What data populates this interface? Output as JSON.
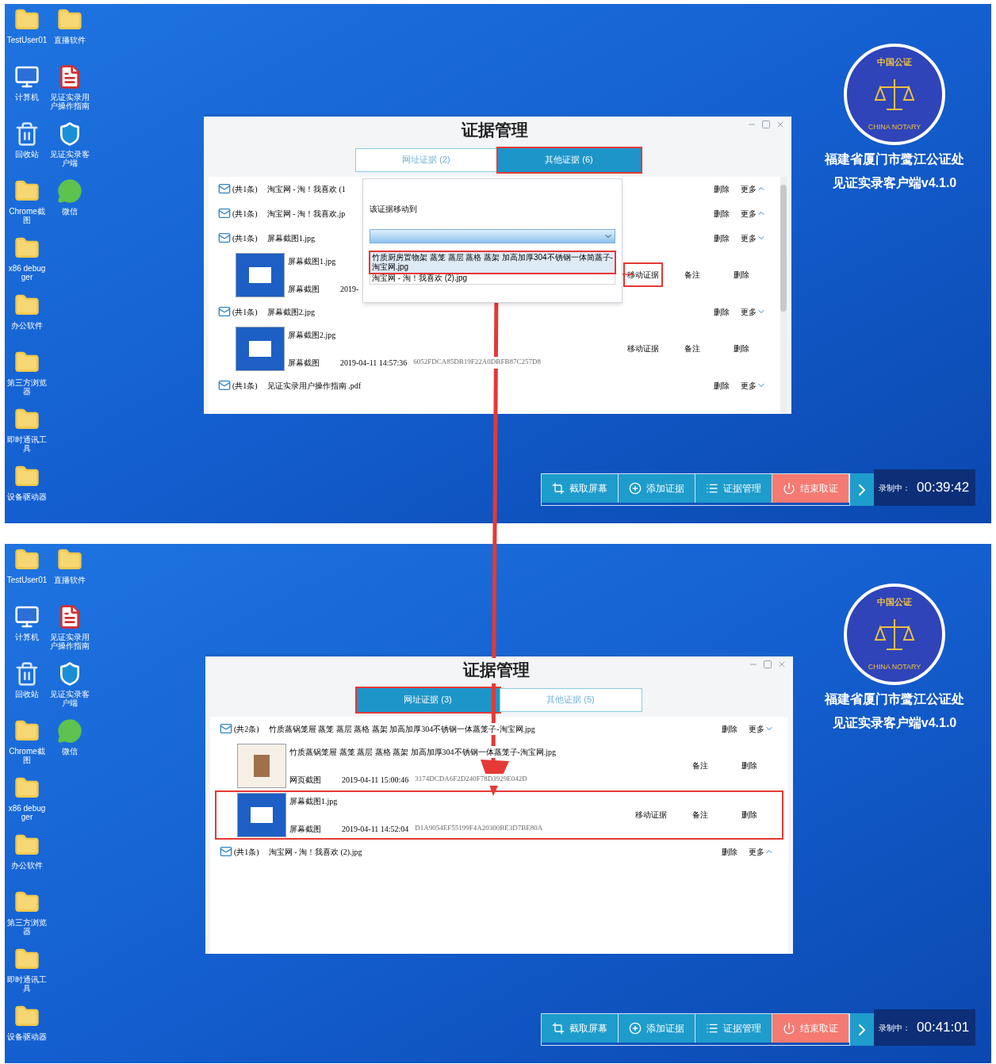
{
  "screens": [
    {
      "desktop_icons": [
        {
          "label": "TestUser01",
          "kind": "folder"
        },
        {
          "label": "直播软件",
          "kind": "folder"
        },
        {
          "label": "计算机",
          "kind": "computer"
        },
        {
          "label": "见证实录用户操作指南",
          "kind": "pdf"
        },
        {
          "label": "回收站",
          "kind": "recycle"
        },
        {
          "label": "见证实录客户端",
          "kind": "app"
        },
        {
          "label": "Chrome截图",
          "kind": "folder"
        },
        {
          "label": "微信",
          "kind": "chat"
        },
        {
          "label": "x86 debugger",
          "kind": "folder"
        },
        {
          "label": "办公软件",
          "kind": "folder"
        },
        {
          "label": "第三方浏览器",
          "kind": "folder"
        },
        {
          "label": "即时通讯工具",
          "kind": "folder"
        },
        {
          "label": "设备驱动器",
          "kind": "folder"
        }
      ],
      "dialog": {
        "title": "证据管理",
        "tabs": [
          {
            "label": "网址证据 (2)",
            "selected": false,
            "marked": false
          },
          {
            "label": "其他证据 (6)",
            "selected": true,
            "marked": true
          }
        ],
        "rows": [
          {
            "kind": "group",
            "count": "(共1条)",
            "name": "淘宝网 - 淘！我喜欢 (1",
            "actions": [
              "删除",
              "更多"
            ],
            "expanded": true
          },
          {
            "kind": "group",
            "count": "(共1条)",
            "name": "淘宝网 - 淘！我喜欢.jp",
            "actions": [
              "删除",
              "更多"
            ],
            "expanded": true
          },
          {
            "kind": "group",
            "count": "(共1条)",
            "name": "屏幕截图1.jpg",
            "actions": [
              "删除",
              "更多"
            ],
            "expanded": false
          },
          {
            "kind": "screenshot",
            "name": "屏幕截图1.jpg",
            "type": "屏幕截图",
            "date": "2019-",
            "marked": false,
            "actions": [
              {
                "label": "移动证据",
                "marked": true
              },
              {
                "label": "备注",
                "marked": false
              },
              {
                "label": "删除",
                "marked": false
              }
            ]
          },
          {
            "kind": "group",
            "count": "(共1条)",
            "name": "屏幕截图2.jpg",
            "actions": [
              "删除",
              "更多"
            ],
            "expanded": false
          },
          {
            "kind": "screenshot",
            "name": "屏幕截图2.jpg",
            "type": "屏幕截图",
            "date": "2019-04-11 14:57:36",
            "hash": "6052FDCA85DB19F22A0DBFB87C257D8",
            "marked": false,
            "actions": [
              {
                "label": "移动证据",
                "marked": false
              },
              {
                "label": "备注",
                "marked": false
              },
              {
                "label": "删除",
                "marked": false
              }
            ]
          },
          {
            "kind": "group",
            "count": "(共1条)",
            "name": "见证实录用户操作指南 .pdf",
            "actions": [
              "删除",
              "更多"
            ],
            "expanded": false
          }
        ],
        "popup": {
          "label": "该证据移动到",
          "options": [
            {
              "label": "竹质厨房置物架 蒸笼 蒸层 蒸格 蒸架 加高加厚304不锈钢一体简蒸子-淘宝网.jpg",
              "marked": true
            },
            {
              "label": "淘宝网 - 淘！我喜欢 (2).jpg",
              "marked": false
            }
          ]
        }
      },
      "brand": {
        "seal_top": "中国公证",
        "seal_bottom": "CHINA NOTARY",
        "lines": [
          "福建省厦门市鹭江公证处",
          "见证实录客户端v4.1.0"
        ]
      },
      "toolbar": {
        "buttons": [
          {
            "label": "截取屏幕",
            "kind": "capture"
          },
          {
            "label": "添加证据",
            "kind": "add"
          },
          {
            "label": "证据管理",
            "kind": "list"
          },
          {
            "label": "结束取证",
            "kind": "stop"
          }
        ],
        "status": "录制中：",
        "timer": "00:39:42"
      }
    },
    {
      "desktop_icons": [
        {
          "label": "TestUser01",
          "kind": "folder"
        },
        {
          "label": "直播软件",
          "kind": "folder"
        },
        {
          "label": "计算机",
          "kind": "computer"
        },
        {
          "label": "见证实录用户操作指南",
          "kind": "pdf"
        },
        {
          "label": "回收站",
          "kind": "recycle"
        },
        {
          "label": "见证实录客户端",
          "kind": "app"
        },
        {
          "label": "Chrome截图",
          "kind": "folder"
        },
        {
          "label": "微信",
          "kind": "chat"
        },
        {
          "label": "x86 debugger",
          "kind": "folder"
        },
        {
          "label": "办公软件",
          "kind": "folder"
        },
        {
          "label": "第三方浏览器",
          "kind": "folder"
        },
        {
          "label": "即时通讯工具",
          "kind": "folder"
        },
        {
          "label": "设备驱动器",
          "kind": "folder"
        }
      ],
      "dialog": {
        "title": "证据管理",
        "tabs": [
          {
            "label": "网址证据 (3)",
            "selected": true,
            "marked": true
          },
          {
            "label": "其他证据 (5)",
            "selected": false,
            "marked": false
          }
        ],
        "rows": [
          {
            "kind": "group",
            "count": "(共2条)",
            "name": "竹质蒸锅笼屉 蒸笼 蒸层 蒸格 蒸架 加高加厚304不锈钢一体蒸笼子-淘宝网.jpg",
            "actions": [
              "删除",
              "更多"
            ],
            "expanded": false
          },
          {
            "kind": "webpage",
            "name": "竹质蒸锅笼屉 蒸笼 蒸层 蒸格 蒸架 加高加厚304不锈钢一体蒸笼子-淘宝网.jpg",
            "type": "网页截图",
            "date": "2019-04-11 15:00:46",
            "hash": "3174DCDA6F2D240F78D3929E042D",
            "marked": false,
            "actions": [
              {
                "label": "备注",
                "marked": false
              },
              {
                "label": "删除",
                "marked": false
              }
            ]
          },
          {
            "kind": "screenshot",
            "name": "屏幕截图1.jpg",
            "type": "屏幕截图",
            "date": "2019-04-11 14:52:04",
            "hash": "D1A9054EF55199F4A20300BE3D7BE80A",
            "marked": true,
            "actions": [
              {
                "label": "移动证据",
                "marked": false
              },
              {
                "label": "备注",
                "marked": false
              },
              {
                "label": "删除",
                "marked": false
              }
            ]
          },
          {
            "kind": "group",
            "count": "(共1条)",
            "name": "淘宝网 - 淘！我喜欢 (2).jpg",
            "actions": [
              "删除",
              "更多"
            ],
            "expanded": true
          }
        ]
      },
      "brand": {
        "seal_top": "中国公证",
        "seal_bottom": "CHINA NOTARY",
        "lines": [
          "福建省厦门市鹭江公证处",
          "见证实录客户端v4.1.0"
        ]
      },
      "toolbar": {
        "buttons": [
          {
            "label": "截取屏幕",
            "kind": "capture"
          },
          {
            "label": "添加证据",
            "kind": "add"
          },
          {
            "label": "证据管理",
            "kind": "list"
          },
          {
            "label": "结束取证",
            "kind": "stop"
          }
        ],
        "status": "录制中：",
        "timer": "00:41:01"
      }
    }
  ]
}
